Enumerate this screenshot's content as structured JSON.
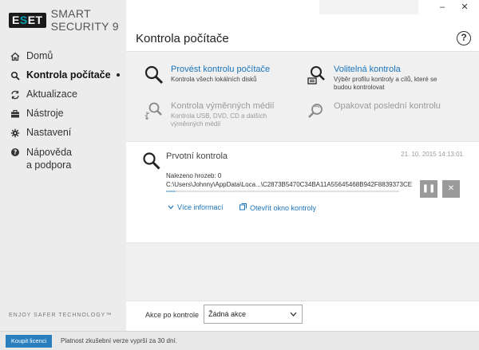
{
  "app": {
    "logo_badge": "ESET",
    "product_name": "SMART SECURITY 9",
    "tagline": "ENJOY SAFER TECHNOLOGY™"
  },
  "window_controls": {
    "minimize": "‒",
    "close": "✕"
  },
  "sidebar": {
    "items": [
      {
        "label": "Domů",
        "icon": "home-icon",
        "active": false
      },
      {
        "label": "Kontrola počítače",
        "icon": "search-icon",
        "active": true
      },
      {
        "label": "Aktualizace",
        "icon": "refresh-icon",
        "active": false
      },
      {
        "label": "Nástroje",
        "icon": "briefcase-icon",
        "active": false
      },
      {
        "label": "Nastavení",
        "icon": "gear-icon",
        "active": false
      },
      {
        "label_line1": "Nápověda",
        "label_line2": "a podpora",
        "icon": "help-icon",
        "active": false
      }
    ]
  },
  "main": {
    "title": "Kontrola počítače",
    "help": "?",
    "actions": [
      {
        "title": "Provést kontrolu počítače",
        "subtitle": "Kontrola všech lokálních disků",
        "icon": "magnifier-icon",
        "enabled": true
      },
      {
        "title": "Volitelná kontrola",
        "subtitle_line1": "Výběr profilu kontroly a cílů, které se",
        "subtitle_line2": "budou kontrolovat",
        "icon": "custom-scan-icon",
        "enabled": true
      },
      {
        "title": "Kontrola výměnných médií",
        "subtitle_line1": "Kontrola USB, DVD, CD a dalších",
        "subtitle_line2": "výměnných médií",
        "icon": "usb-scan-icon",
        "enabled": false
      },
      {
        "title": "Opakovat poslední kontrolu",
        "icon": "repeat-scan-icon",
        "enabled": false
      }
    ],
    "scan": {
      "title": "Prvotní kontrola",
      "date": "21. 10. 2015 14:13:01",
      "found": "Nalezeno hrozeb: 0",
      "path": "C:\\Users\\Johnny\\AppData\\Loca...\\C2873B5470C34BA11A55645468B942F8839373CE",
      "progress": 0.04,
      "pause": "❚❚",
      "stop": "✕",
      "more_info": "Více informací",
      "open_window": "Otevřít okno kontroly"
    },
    "after_scan": {
      "label": "Akce po kontrole",
      "selected": "Žádná akce"
    }
  },
  "footer": {
    "buy_button": "Koupit licenci",
    "trial_text": "Platnost zkušební verze vyprší za 30 dní."
  },
  "colors": {
    "accent": "#1a74ba",
    "buy_button": "#2a7fc0",
    "sidebar_bg": "#ececec",
    "main_bg": "#f0f0f0"
  }
}
